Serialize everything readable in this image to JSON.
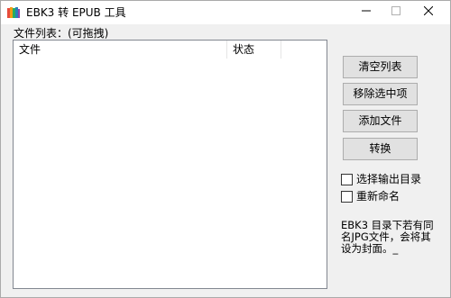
{
  "window": {
    "title": "EBK3 转 EPUB 工具",
    "icon": "colorful-book-icon"
  },
  "controls": {
    "minimize": "minimize-icon",
    "maximize": "maximize-icon",
    "close": "close-icon"
  },
  "file_list": {
    "label": "文件列表：(可拖拽)",
    "columns": [
      "文件",
      "状态"
    ],
    "rows": []
  },
  "buttons": {
    "clear": "清空列表",
    "remove": "移除选中项",
    "add": "添加文件",
    "convert": "转换"
  },
  "options": {
    "select_output": {
      "label": "选择输出目录",
      "checked": false
    },
    "rename": {
      "label": "重新命名",
      "checked": false
    }
  },
  "note": "EBK3 目录下若有同名JPG文件，会将其设为封面。_",
  "colors": {
    "window_bg": "#f0f0f0",
    "button_bg": "#e1e1e1",
    "button_border": "#adadad"
  }
}
